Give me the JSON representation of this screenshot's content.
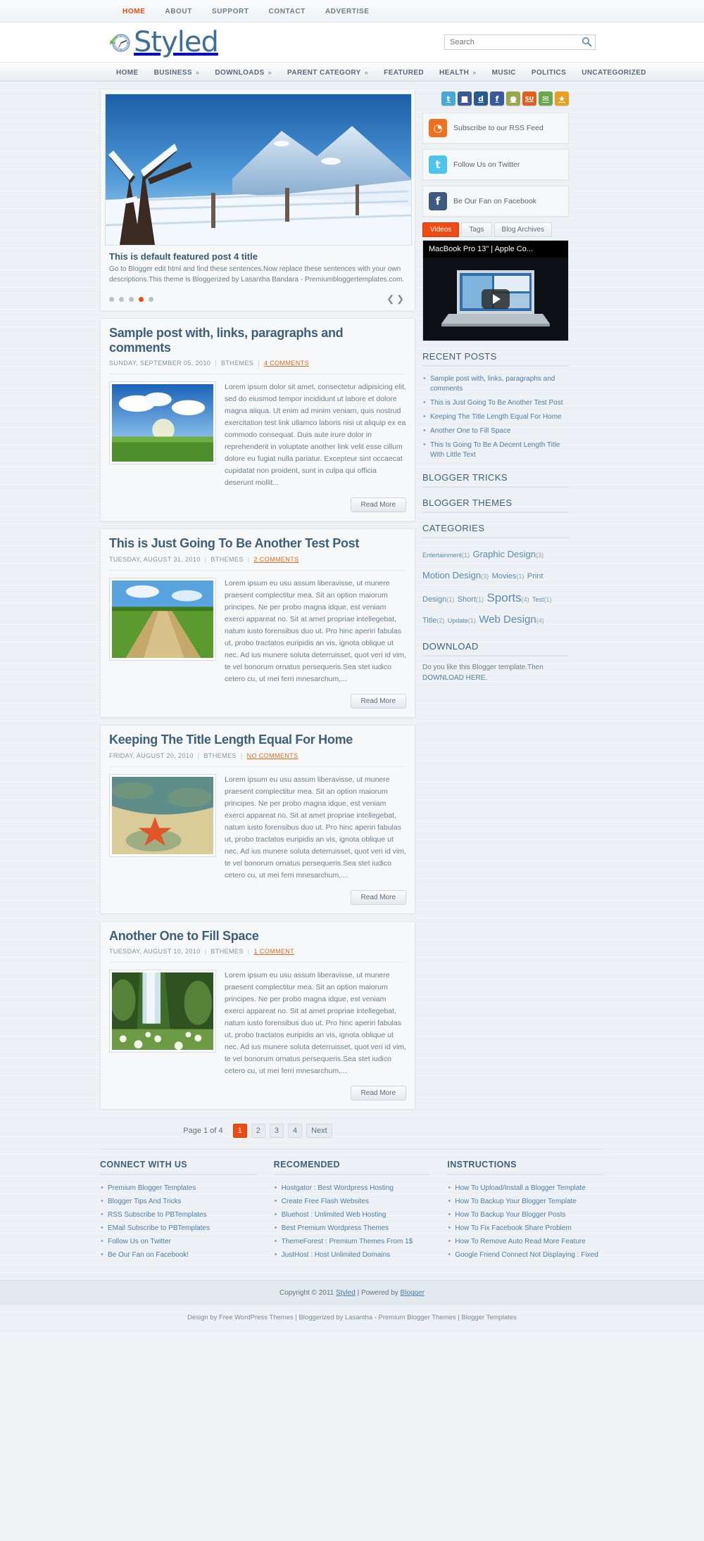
{
  "topnav": [
    {
      "label": "HOME",
      "active": true
    },
    {
      "label": "ABOUT",
      "active": false
    },
    {
      "label": "SUPPORT",
      "active": false
    },
    {
      "label": "CONTACT",
      "active": false
    },
    {
      "label": "ADVERTISE",
      "active": false
    }
  ],
  "brand": {
    "name": "Styled",
    "logo_icon": "clock-refresh-icon"
  },
  "search": {
    "placeholder": "Search",
    "value": "",
    "icon": "search-icon"
  },
  "mainnav": [
    {
      "label": "HOME",
      "caret": false
    },
    {
      "label": "BUSINESS",
      "caret": true
    },
    {
      "label": "DOWNLOADS",
      "caret": true
    },
    {
      "label": "PARENT CATEGORY",
      "caret": true
    },
    {
      "label": "FEATURED",
      "caret": false
    },
    {
      "label": "HEALTH",
      "caret": true
    },
    {
      "label": "MUSIC",
      "caret": false
    },
    {
      "label": "POLITICS",
      "caret": false
    },
    {
      "label": "UNCATEGORIZED",
      "caret": false
    }
  ],
  "slider": {
    "title": "This is default featured post 4 title",
    "description": "Go to Blogger edit html and find these sentences.Now replace these sentences with your own descriptions.This theme is Bloggerized by Lasantha Bandara - Premiumbloggertemplates.com.",
    "dots": 5,
    "active_dot": 4,
    "prev_icon": "chevron-left-icon",
    "next_icon": "chevron-right-icon",
    "image_alt": "snowy-trees-and-fence-winter-mountain"
  },
  "posts": [
    {
      "title": "Sample post with, links, paragraphs and comments",
      "date": "SUNDAY, SEPTEMBER 05, 2010",
      "author": "BTHEMES",
      "comments": "4 COMMENTS",
      "image_alt": "green-field-with-clouds-and-sun",
      "excerpt": "Lorem ipsum dolor sit amet, consectetur adipisicing elit, sed do eiusmod tempor incididunt ut labore et dolore magna aliqua. Ut enim ad minim veniam, quis nostrud exercitation test link ullamco laboris nisi ut aliquip ex ea commodo consequat. Duis aute irure dolor in reprehenderit in voluptate another link velit esse cillum dolore eu fugiat nulla pariatur. Excepteur sint occaecat cupidatat non proident, sunt in culpa qui officia deserunt mollit...",
      "read_more": "Read More"
    },
    {
      "title": "This is Just Going To Be Another Test Post",
      "date": "TUESDAY, AUGUST 31, 2010",
      "author": "BTHEMES",
      "comments": "2 COMMENTS",
      "image_alt": "dirt-road-through-green-meadow",
      "excerpt": "Lorem ipsum eu usu assum liberavisse, ut munere praesent complectitur mea. Sit an option maiorum principes. Ne per probo magna idque, est veniam exerci appareat no. Sit at amet propriae intellegebat, natum iusto forensibus duo ut. Pro hinc aperiri fabulas ut, probo tractatos euripidis an vis, ignota oblique ut nec. Ad ius munere soluta deterruisset, quot veri id vim, te vel bonorum ornatus persequeris.Sea stet iudico cetero cu, ut mei ferri mnesarchum,...",
      "read_more": "Read More"
    },
    {
      "title": "Keeping The Title Length Equal For Home",
      "date": "FRIDAY, AUGUST 20, 2010",
      "author": "BTHEMES",
      "comments": "NO COMMENTS",
      "image_alt": "starfish-in-shallow-clear-water",
      "excerpt": "Lorem ipsum eu usu assum liberavisse, ut munere praesent complectitur mea. Sit an option maiorum principes. Ne per probo magna idque, est veniam exerci appareat no. Sit at amet propriae intellegebat, natum iusto forensibus duo ut. Pro hinc aperiri fabulas ut, probo tractatos euripidis an vis, ignota oblique ut nec. Ad ius munere soluta deterruisset, quot veri id vim, te vel bonorum ornatus persequeris.Sea stet iudico cetero cu, ut mei ferri mnesarchum,...",
      "read_more": "Read More"
    },
    {
      "title": "Another One to Fill Space",
      "date": "TUESDAY, AUGUST 10, 2010",
      "author": "BTHEMES",
      "comments": "1 COMMENT",
      "image_alt": "waterfall-in-forest-with-white-flowers",
      "excerpt": "Lorem ipsum eu usu assum liberavisse, ut munere praesent complectitur mea. Sit an option maiorum principes. Ne per probo magna idque, est veniam exerci appareat no. Sit at amet propriae intellegebat, natum iusto forensibus duo ut. Pro hinc aperiri fabulas ut, probo tractatos euripidis an vis, ignota oblique ut nec. Ad ius munere soluta deterruisset, quot veri id vim, te vel bonorum ornatus persequeris.Sea stet iudico cetero cu, ut mei ferri mnesarchum,...",
      "read_more": "Read More"
    }
  ],
  "pager": {
    "label": "Page 1 of 4",
    "pages": [
      "1",
      "2",
      "3",
      "4"
    ],
    "active_page": "1",
    "next_label": "Next"
  },
  "sidebar": {
    "social_icons": [
      {
        "name": "twitter-icon",
        "glyph": "t",
        "color": "#4aa8d8"
      },
      {
        "name": "delicious-icon",
        "glyph": "■",
        "color": "#3b5998"
      },
      {
        "name": "digg-icon",
        "glyph": "d",
        "color": "#2b5a8c"
      },
      {
        "name": "facebook-icon",
        "glyph": "f",
        "color": "#3b5998"
      },
      {
        "name": "rss-icon",
        "glyph": "●",
        "color": "#9aa74a"
      },
      {
        "name": "stumbleupon-icon",
        "glyph": "SU",
        "color": "#e06020"
      },
      {
        "name": "technorati-icon",
        "glyph": "✉",
        "color": "#6aa84f"
      },
      {
        "name": "share-icon",
        "glyph": "★",
        "color": "#e8a020"
      }
    ],
    "subscriptions": [
      {
        "label": "Subscribe to our RSS Feed",
        "icon": "rss-feed-icon",
        "glyph": "◔",
        "color": "#f07020"
      },
      {
        "label": "Follow Us on Twitter",
        "icon": "twitter-bird-icon",
        "glyph": "t",
        "color": "#4fc3ef"
      },
      {
        "label": "Be Our Fan on Facebook",
        "icon": "facebook-f-icon",
        "glyph": "f",
        "color": "#3d5a80"
      }
    ],
    "tabs": [
      {
        "label": "Videos",
        "active": true
      },
      {
        "label": "Tags",
        "active": false
      },
      {
        "label": "Blog Archives",
        "active": false
      }
    ],
    "video": {
      "title": "MacBook Pro 13\" | Apple Co...",
      "play_icon": "play-button-icon"
    },
    "recent_posts": {
      "title": "RECENT POSTS",
      "items": [
        "Sample post with, links, paragraphs and comments",
        "This is Just Going To Be Another Test Post",
        "Keeping The Title Length Equal For Home",
        "Another One to Fill Space",
        "This Is Going To Be A Decent Length Title With Little Text"
      ]
    },
    "blogger_tricks_title": "BLOGGER TRICKS",
    "blogger_themes_title": "BLOGGER THEMES",
    "categories": {
      "title": "CATEGORIES",
      "items": [
        {
          "label": "Entertainment",
          "count": "(1)",
          "size": "c-xs"
        },
        {
          "label": "Graphic Design",
          "count": "(3)",
          "size": "c-m"
        },
        {
          "label": "Motion Design",
          "count": "(3)",
          "size": "c-m"
        },
        {
          "label": "Movies",
          "count": "(1)",
          "size": "c-s"
        },
        {
          "label": "Print Design",
          "count": "(1)",
          "size": "c-s"
        },
        {
          "label": "Short",
          "count": "(1)",
          "size": "c-s"
        },
        {
          "label": "Sports",
          "count": "(4)",
          "size": "c-xl"
        },
        {
          "label": "Test",
          "count": "(1)",
          "size": "c-xs"
        },
        {
          "label": "Title",
          "count": "(2)",
          "size": "c-s"
        },
        {
          "label": "Update",
          "count": "(1)",
          "size": "c-xs"
        },
        {
          "label": "Web Design",
          "count": "(4)",
          "size": "c-l"
        }
      ]
    },
    "download": {
      "title": "DOWNLOAD",
      "text": "Do you like this Blogger template.Then ",
      "link": "DOWNLOAD HERE."
    }
  },
  "footer": {
    "columns": [
      {
        "title": "CONNECT WITH US",
        "items": [
          "Premium Blogger Templates",
          "Blogger Tips And Tricks",
          "RSS Subscribe to PBTemplates",
          "EMail Subscribe to PBTemplates",
          "Follow Us on Twitter",
          "Be Our Fan on Facebook!"
        ]
      },
      {
        "title": "RECOMENDED",
        "items": [
          "Hostgator : Best Wordpress Hosting",
          "Create Free Flash Websites",
          "Bluehost : Unlimited Web Hosting",
          "Best Premium Wordpress Themes",
          "ThemeForest : Premium Themes From 1$",
          "JustHost : Host Unlimited Domains"
        ]
      },
      {
        "title": "INSTRUCTIONS",
        "items": [
          "How To Upload/Install a Blogger Template",
          "How To Backup Your Blogger Template",
          "How To Backup Your Blogger Posts",
          "How To Fix Facebook Share Problem",
          "How To Remove Auto Read More Feature",
          "Google Friend Connect Not Displaying : Fixed"
        ]
      }
    ],
    "copyright_prefix": "Copyright © 2011 ",
    "copyright_brand": "Styled",
    "copyright_mid": " | Powered by ",
    "copyright_platform": "Blogger",
    "credits": "Design by Free WordPress Themes | Bloggerized by Lasantha - Premium Blogger Themes | Blogger Templates"
  },
  "colors": {
    "accent": "#ee4a12",
    "heading": "#3e5f7c",
    "link": "#4d7da8",
    "page_bg": "#eef2f5"
  }
}
